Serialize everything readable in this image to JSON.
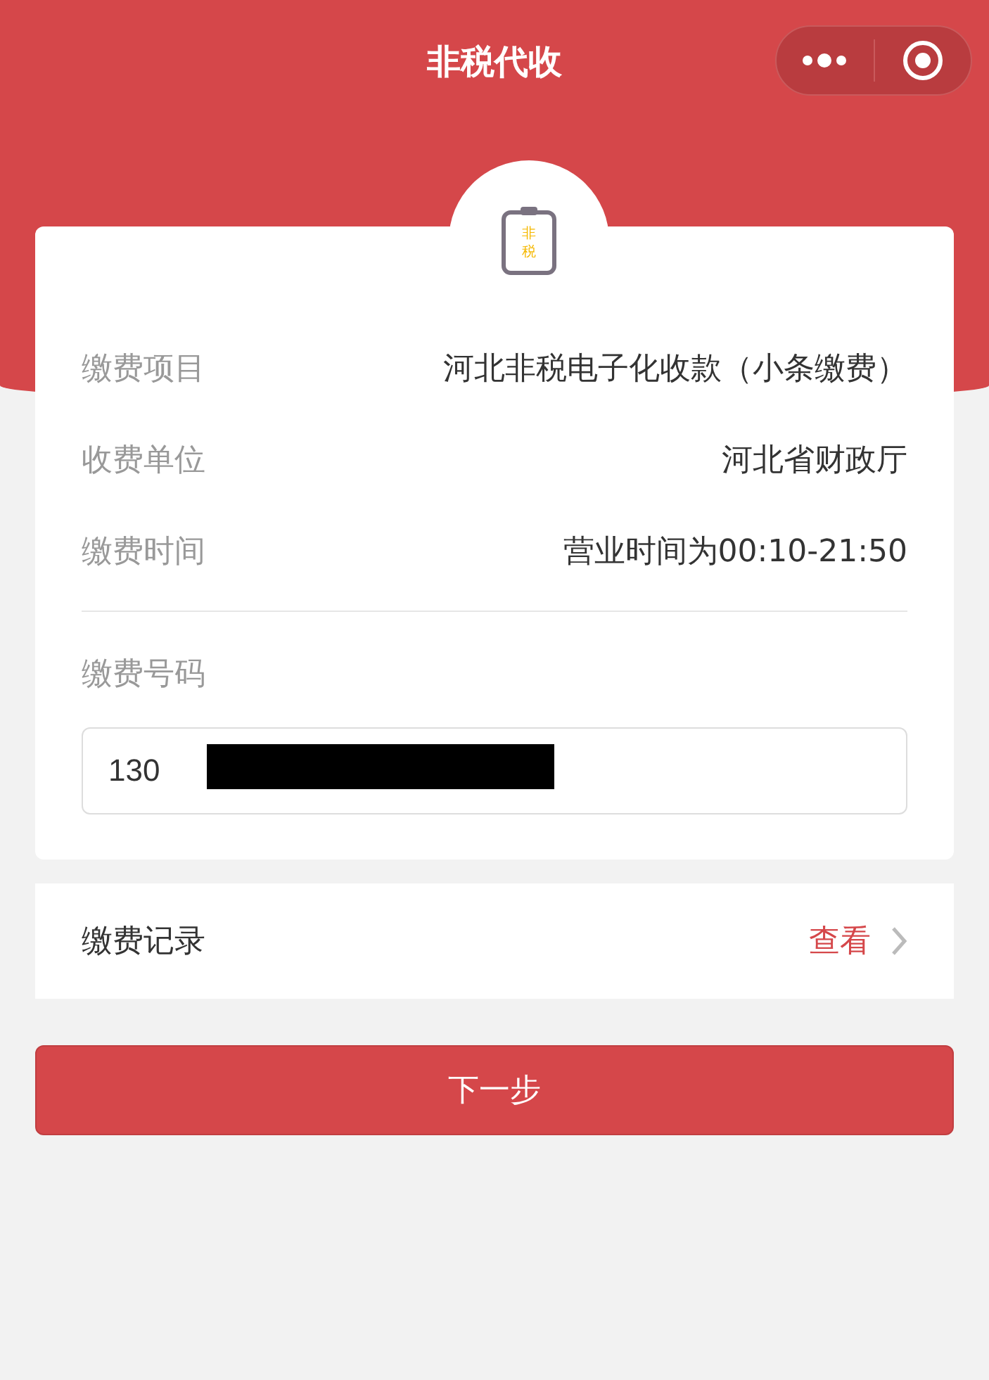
{
  "nav": {
    "title": "非税代收"
  },
  "badge": {
    "icon_text": [
      "非",
      "税"
    ]
  },
  "details": [
    {
      "label": "缴费项目",
      "value": "河北非税电子化收款（小条缴费）"
    },
    {
      "label": "收费单位",
      "value": "河北省财政厅"
    },
    {
      "label": "缴费时间",
      "value": "营业时间为00:10-21:50"
    }
  ],
  "payment_number": {
    "label": "缴费号码",
    "value": "130",
    "redacted": true
  },
  "records": {
    "label": "缴费记录",
    "link": "查看"
  },
  "next_button": "下一步"
}
